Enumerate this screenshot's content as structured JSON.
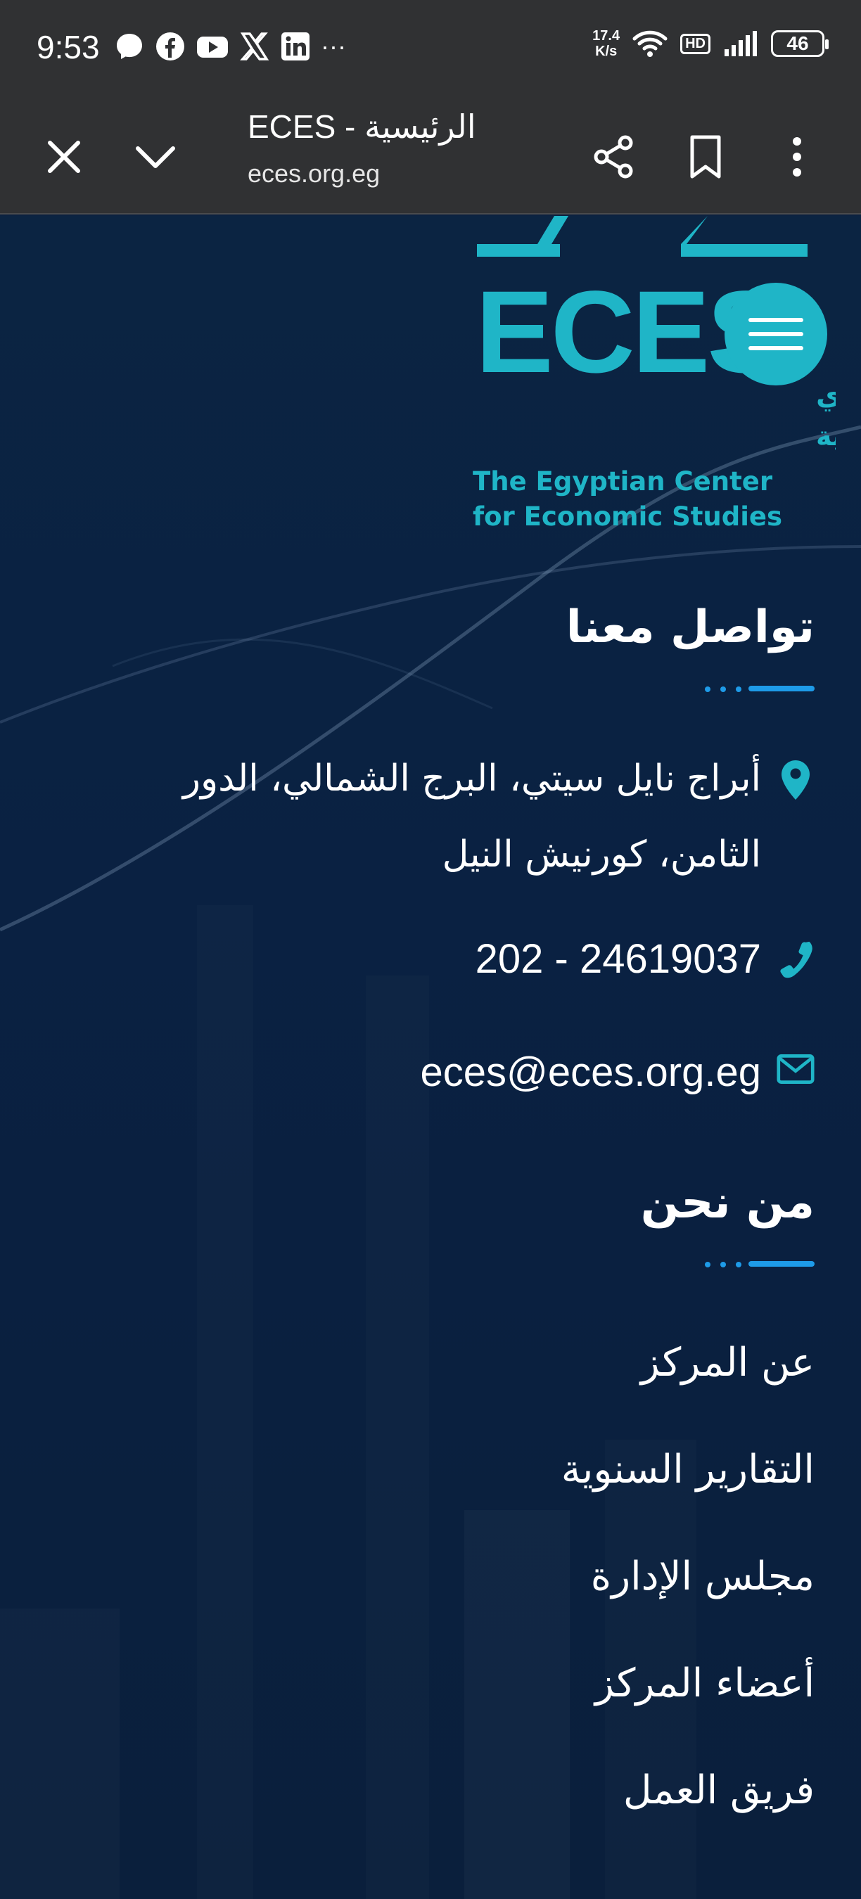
{
  "status_bar": {
    "time": "9:53",
    "left_icons": [
      "messenger-icon",
      "facebook-icon",
      "youtube-icon",
      "x-icon",
      "linkedin-icon",
      "more-dots-icon"
    ],
    "more_dots": "···",
    "net_speed_value": "17.4",
    "net_speed_unit": "K/s",
    "hd_label": "HD",
    "battery_level": "46"
  },
  "browser": {
    "title": "ECES - الرئيسية",
    "url": "eces.org.eg"
  },
  "logo": {
    "brand_letters": "ECES",
    "arabic_line1": "المركز المصري",
    "arabic_line2": "للدراسات الاقتصادية",
    "english_line1": "The Egyptian Center",
    "english_line2": "for Economic Studies",
    "color": "#1fb5c7"
  },
  "contact": {
    "heading": "تواصل معنا",
    "address_line1": "أبراج نايل سيتي، البرج الشمالي، الدور",
    "address_line2": "الثامن، كورنيش النيل",
    "phone": "202 - 24619037",
    "email": "eces@eces.org.eg"
  },
  "about": {
    "heading": "من نحن",
    "links": [
      "عن المركز",
      "التقارير السنوية",
      "مجلس الإدارة",
      "أعضاء المركز",
      "فريق العمل"
    ]
  },
  "colors": {
    "accent": "#1fb5c7",
    "underline": "#1e9be8",
    "background": "#0b2140",
    "chrome": "#303133"
  }
}
